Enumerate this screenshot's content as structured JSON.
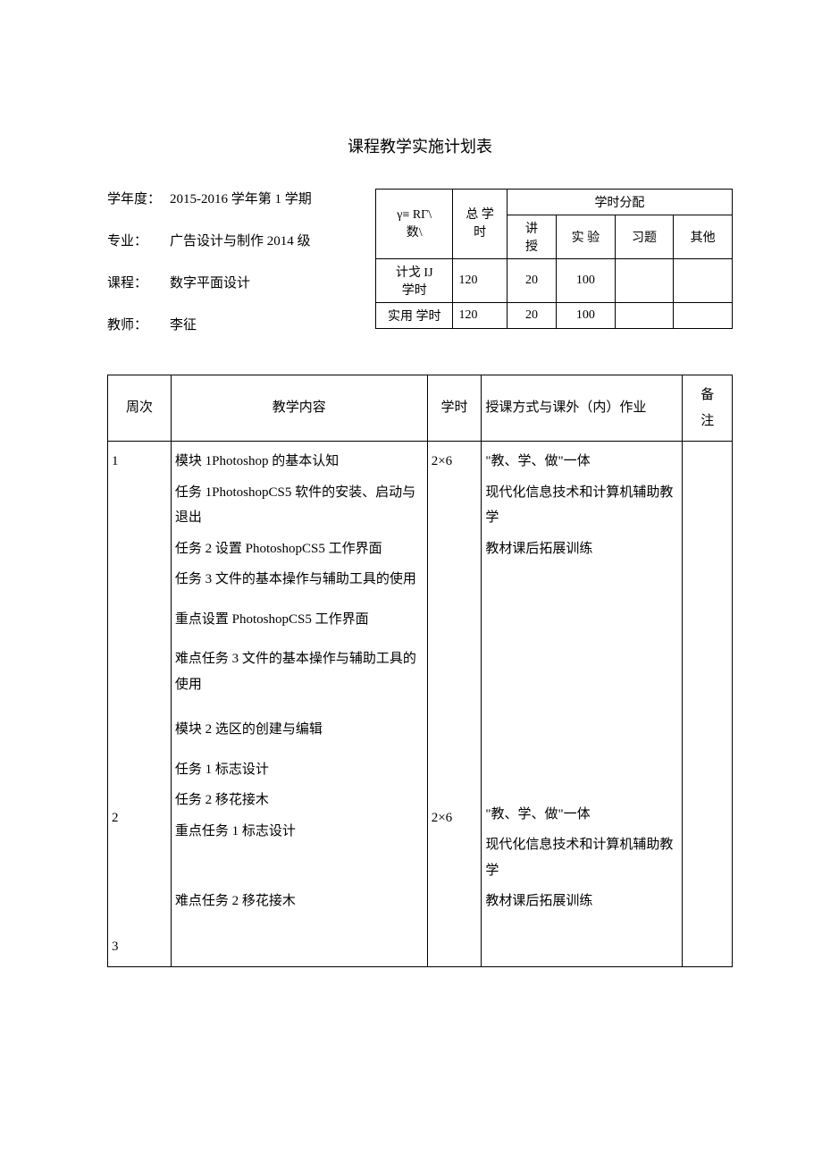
{
  "title": "课程教学实施计划表",
  "info": {
    "year_label": "学年度：",
    "year_value": "2015-2016 学年第 1 学期",
    "major_label": "专业：",
    "major_value": "广告设计与制作 2014 级",
    "course_label": "课程：",
    "course_value": "数字平面设计",
    "teacher_label": "教师：",
    "teacher_value": "李征"
  },
  "alloc": {
    "corner": "γ≡ RΓ\\\n数\\",
    "total_header": "总 学\n时",
    "dist_header": "学时分配",
    "sub_headers": [
      "讲\n授",
      "实 验",
      "习题",
      "其他"
    ],
    "rows": [
      {
        "label": "计戈 IJ\n学时",
        "total": "120",
        "vals": [
          "20",
          "100",
          "",
          ""
        ]
      },
      {
        "label": "实用 学时",
        "total": "120",
        "vals": [
          "20",
          "100",
          "",
          ""
        ]
      }
    ]
  },
  "main": {
    "headers": {
      "week": "周次",
      "content": "教学内容",
      "hours": "学时",
      "method": "授课方式与课外（内）作业",
      "note": "备\n注"
    },
    "rows": [
      {
        "week": "1",
        "content_lines": [
          "模块 1Photoshop 的基本认知",
          "任务 1PhotoshopCS5 软件的安装、启动与退出",
          "任务 2 设置 PhotoshopCS5 工作界面",
          "任务 3 文件的基本操作与辅助工具的使用",
          "重点设置 PhotoshopCS5 工作界面",
          "难点任务 3 文件的基本操作与辅助工具的使用"
        ],
        "hours": "2×6",
        "method_lines": [
          "\"教、学、做\"一体",
          "现代化信息技术和计算机辅助教学",
          "教材课后拓展训练"
        ],
        "note": ""
      },
      {
        "week": "2",
        "content_lines": [
          "模块 2 选区的创建与编辑",
          "任务 1 标志设计",
          "任务 2 移花接木",
          "重点任务 1 标志设计",
          "难点任务 2 移花接木"
        ],
        "hours": "2×6",
        "method_lines": [
          "\"教、学、做\"一体",
          "现代化信息技术和计算机辅助教学",
          "教材课后拓展训练"
        ],
        "note": ""
      },
      {
        "week": "3",
        "content_lines": [],
        "hours": "",
        "method_lines": [],
        "note": ""
      }
    ]
  }
}
